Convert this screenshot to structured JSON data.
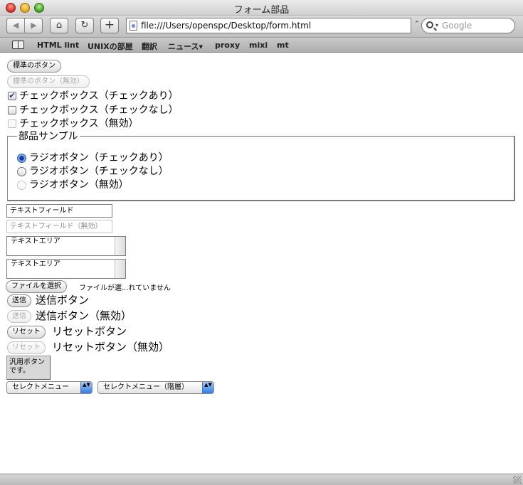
{
  "window": {
    "title": "フォーム部品"
  },
  "toolbar": {
    "back_glyph": "◀",
    "forward_glyph": "▶",
    "home_glyph": "⌂",
    "reload_glyph": "↻",
    "add_glyph": "+",
    "url": "file:///Users/openspc/Desktop/form.html",
    "search_placeholder": "Google"
  },
  "bookmarks": [
    "HTML lint",
    "UNIXの部屋",
    "翻訳",
    "ニュース▾",
    "proxy",
    "mixi",
    "mt"
  ],
  "form": {
    "standard_button": "標準のボタン",
    "standard_button_disabled": "標準のボタン（無効）",
    "checkbox_checked": "チェックボックス（チェックあり）",
    "checkbox_unchecked": "チェックボックス（チェックなし）",
    "checkbox_disabled": "チェックボックス（無効）",
    "checkmark": "✔",
    "fieldset_legend": "部品サンプル",
    "radio_checked": "ラジオボタン（チェックあり）",
    "radio_unchecked": "ラジオボタン（チェックなし）",
    "radio_disabled": "ラジオボタン（無効）",
    "text_field": "テキストフィールド",
    "text_field_disabled": "テキストフィールド（無効）",
    "textarea_1": "テキストエリア",
    "textarea_2": "テキストエリア",
    "file_button": "ファイルを選択",
    "file_status": "ファイルが選...れていません",
    "submit_button": "送信",
    "submit_label": "送信ボタン",
    "submit_button_disabled": "送信",
    "submit_label_disabled": "送信ボタン（無効）",
    "reset_button": "リセット",
    "reset_label": "リセットボタン",
    "reset_button_disabled": "リセット",
    "reset_label_disabled": "リセットボタン（無効）",
    "generic_button": "汎用ボタンです。",
    "select_1": "セレクトメニュー",
    "select_2": "セレクトメニュー（階層）",
    "select_arrows": "▲▼"
  },
  "colors": {
    "accent": "#2f7be6",
    "checked_radio": "#123c8f"
  },
  "icons": [
    "back-icon",
    "forward-icon",
    "home-icon",
    "reload-icon",
    "add-bookmark-icon",
    "document-icon",
    "search-icon",
    "bookmarks-book-icon",
    "resize-grip-icon"
  ]
}
